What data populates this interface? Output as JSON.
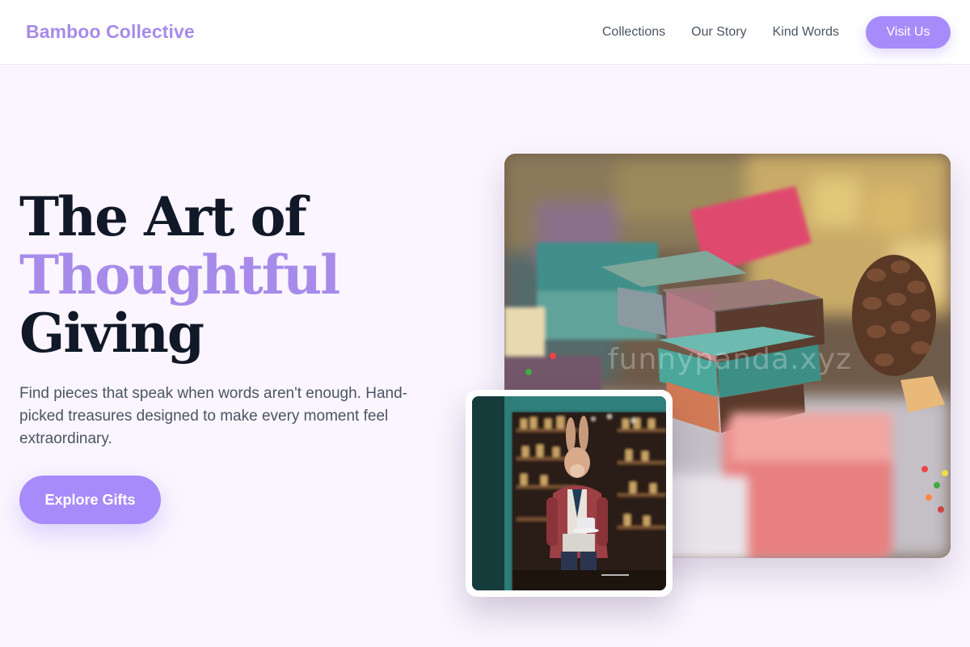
{
  "nav": {
    "brand": "Bamboo Collective",
    "links": [
      "Collections",
      "Our Story",
      "Kind Words"
    ],
    "cta": "Visit Us"
  },
  "hero": {
    "title_line1": "The Art of",
    "title_line2": "Thoughtful",
    "title_line3": "Giving",
    "subtitle": "Find pieces that speak when words aren't enough. Hand-picked treasures designed to make every moment feel extraordinary.",
    "button": "Explore Gifts"
  },
  "images": {
    "main_watermark": "funnypanda.xyz"
  },
  "colors": {
    "accent": "#a78bfa",
    "brand": "#a78bea",
    "background": "#faf5fe",
    "heading": "#111827"
  }
}
